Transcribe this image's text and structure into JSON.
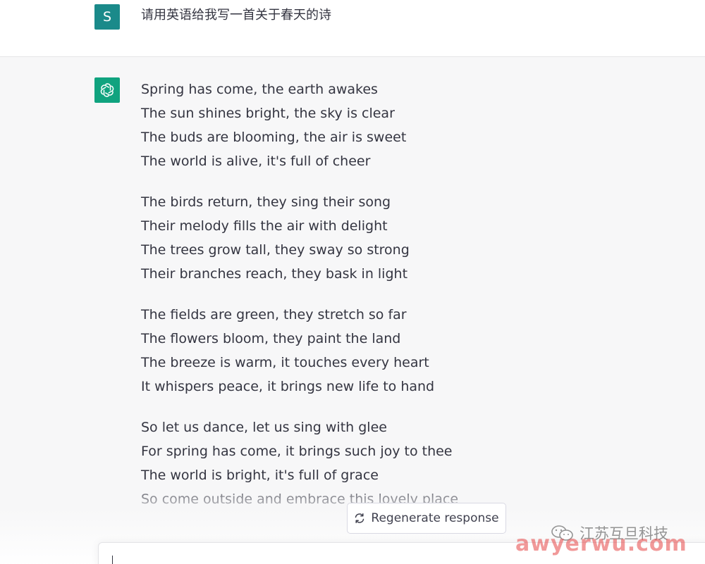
{
  "user_message": {
    "avatar_letter": "S",
    "text": "请用英语给我写一首关于春天的诗"
  },
  "assistant_message": {
    "stanzas": [
      [
        "Spring has come, the earth awakes",
        "The sun shines bright, the sky is clear",
        "The buds are blooming, the air is sweet",
        "The world is alive, it's full of cheer"
      ],
      [
        "The birds return, they sing their song",
        "Their melody fills the air with delight",
        "The trees grow tall, they sway so strong",
        "Their branches reach, they bask in light"
      ],
      [
        "The fields are green, they stretch so far",
        "The flowers bloom, they paint the land",
        "The breeze is warm, it touches every heart",
        "It whispers peace, it brings new life to hand"
      ],
      [
        "So let us dance, let us sing with glee",
        "For spring has come, it brings such joy to thee",
        "The world is bright, it's full of grace",
        "So come outside and embrace this lovely place"
      ]
    ]
  },
  "regenerate_button": {
    "label": "Regenerate response",
    "icon": "refresh-icon"
  },
  "composer": {
    "value": ""
  },
  "watermark": {
    "account": "江苏互旦科技",
    "url": "awyerwu.com",
    "icon": "wechat-icon"
  },
  "colors": {
    "user_avatar": "#1a8a8a",
    "assistant_avatar": "#10a37f",
    "assistant_bg": "#f7f7f8",
    "text": "#343541"
  }
}
